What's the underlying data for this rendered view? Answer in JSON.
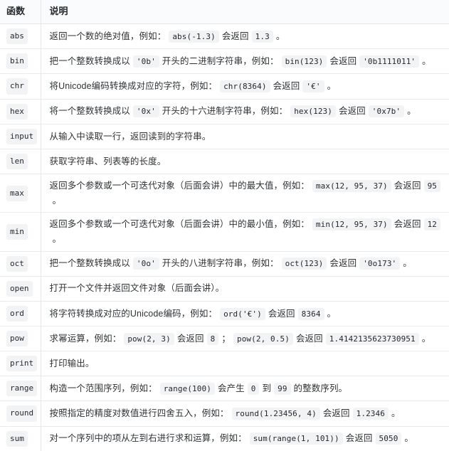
{
  "table": {
    "headers": {
      "function": "函数",
      "description": "说明"
    },
    "rows": [
      {
        "name": "abs",
        "parts": [
          {
            "t": "text",
            "v": "返回一个数的绝对值，例如："
          },
          {
            "t": "code",
            "v": "abs(-1.3)"
          },
          {
            "t": "text",
            "v": "会返回"
          },
          {
            "t": "code",
            "v": "1.3"
          },
          {
            "t": "text",
            "v": "。"
          }
        ]
      },
      {
        "name": "bin",
        "parts": [
          {
            "t": "text",
            "v": "把一个整数转换成以"
          },
          {
            "t": "code",
            "v": "'0b'"
          },
          {
            "t": "text",
            "v": "开头的二进制字符串，例如："
          },
          {
            "t": "code",
            "v": "bin(123)"
          },
          {
            "t": "text",
            "v": "会返回"
          },
          {
            "t": "code",
            "v": "'0b1111011'"
          },
          {
            "t": "text",
            "v": "。"
          }
        ]
      },
      {
        "name": "chr",
        "parts": [
          {
            "t": "text",
            "v": "将Unicode编码转换成对应的字符，例如："
          },
          {
            "t": "code",
            "v": "chr(8364)"
          },
          {
            "t": "text",
            "v": "会返回"
          },
          {
            "t": "code",
            "v": "'€'"
          },
          {
            "t": "text",
            "v": "。"
          }
        ]
      },
      {
        "name": "hex",
        "parts": [
          {
            "t": "text",
            "v": "将一个整数转换成以"
          },
          {
            "t": "code",
            "v": "'0x'"
          },
          {
            "t": "text",
            "v": "开头的十六进制字符串，例如："
          },
          {
            "t": "code",
            "v": "hex(123)"
          },
          {
            "t": "text",
            "v": "会返回"
          },
          {
            "t": "code",
            "v": "'0x7b'"
          },
          {
            "t": "text",
            "v": "。"
          }
        ]
      },
      {
        "name": "input",
        "parts": [
          {
            "t": "text",
            "v": "从输入中读取一行，返回读到的字符串。"
          }
        ]
      },
      {
        "name": "len",
        "parts": [
          {
            "t": "text",
            "v": "获取字符串、列表等的长度。"
          }
        ]
      },
      {
        "name": "max",
        "parts": [
          {
            "t": "text",
            "v": "返回多个参数或一个可迭代对象（后面会讲）中的最大值，例如："
          },
          {
            "t": "code",
            "v": "max(12, 95, 37)"
          },
          {
            "t": "text",
            "v": "会返回"
          },
          {
            "t": "code",
            "v": "95"
          },
          {
            "t": "text",
            "v": "。"
          }
        ]
      },
      {
        "name": "min",
        "parts": [
          {
            "t": "text",
            "v": "返回多个参数或一个可迭代对象（后面会讲）中的最小值，例如："
          },
          {
            "t": "code",
            "v": "min(12, 95, 37)"
          },
          {
            "t": "text",
            "v": "会返回"
          },
          {
            "t": "code",
            "v": "12"
          },
          {
            "t": "text",
            "v": "。"
          }
        ]
      },
      {
        "name": "oct",
        "parts": [
          {
            "t": "text",
            "v": "把一个整数转换成以"
          },
          {
            "t": "code",
            "v": "'0o'"
          },
          {
            "t": "text",
            "v": "开头的八进制字符串，例如："
          },
          {
            "t": "code",
            "v": "oct(123)"
          },
          {
            "t": "text",
            "v": "会返回"
          },
          {
            "t": "code",
            "v": "'0o173'"
          },
          {
            "t": "text",
            "v": "。"
          }
        ]
      },
      {
        "name": "open",
        "parts": [
          {
            "t": "text",
            "v": "打开一个文件并返回文件对象（后面会讲）。"
          }
        ]
      },
      {
        "name": "ord",
        "parts": [
          {
            "t": "text",
            "v": "将字符转换成对应的Unicode编码，例如："
          },
          {
            "t": "code",
            "v": "ord('€')"
          },
          {
            "t": "text",
            "v": "会返回"
          },
          {
            "t": "code",
            "v": "8364"
          },
          {
            "t": "text",
            "v": "。"
          }
        ]
      },
      {
        "name": "pow",
        "parts": [
          {
            "t": "text",
            "v": "求幂运算，例如："
          },
          {
            "t": "code",
            "v": "pow(2, 3)"
          },
          {
            "t": "text",
            "v": "会返回"
          },
          {
            "t": "code",
            "v": "8"
          },
          {
            "t": "text",
            "v": "；"
          },
          {
            "t": "code",
            "v": "pow(2, 0.5)"
          },
          {
            "t": "text",
            "v": "会返回"
          },
          {
            "t": "code",
            "v": "1.4142135623730951"
          },
          {
            "t": "text",
            "v": "。"
          }
        ]
      },
      {
        "name": "print",
        "parts": [
          {
            "t": "text",
            "v": "打印输出。"
          }
        ]
      },
      {
        "name": "range",
        "parts": [
          {
            "t": "text",
            "v": "构造一个范围序列，例如："
          },
          {
            "t": "code",
            "v": "range(100)"
          },
          {
            "t": "text",
            "v": "会产生"
          },
          {
            "t": "code",
            "v": "0"
          },
          {
            "t": "text",
            "v": "到"
          },
          {
            "t": "code",
            "v": "99"
          },
          {
            "t": "text",
            "v": "的整数序列。"
          }
        ]
      },
      {
        "name": "round",
        "parts": [
          {
            "t": "text",
            "v": "按照指定的精度对数值进行四舍五入，例如："
          },
          {
            "t": "code",
            "v": "round(1.23456, 4)"
          },
          {
            "t": "text",
            "v": "会返回"
          },
          {
            "t": "code",
            "v": "1.2346"
          },
          {
            "t": "text",
            "v": "。"
          }
        ]
      },
      {
        "name": "sum",
        "parts": [
          {
            "t": "text",
            "v": "对一个序列中的项从左到右进行求和运算，例如："
          },
          {
            "t": "code",
            "v": "sum(range(1, 101))"
          },
          {
            "t": "text",
            "v": "会返回"
          },
          {
            "t": "code",
            "v": "5050"
          },
          {
            "t": "text",
            "v": "。"
          }
        ]
      }
    ]
  },
  "colors": {
    "header_bg": "#fafbfc",
    "border": "#e8eaed",
    "code_bg": "#f2f3f5",
    "text": "#2f3336"
  }
}
